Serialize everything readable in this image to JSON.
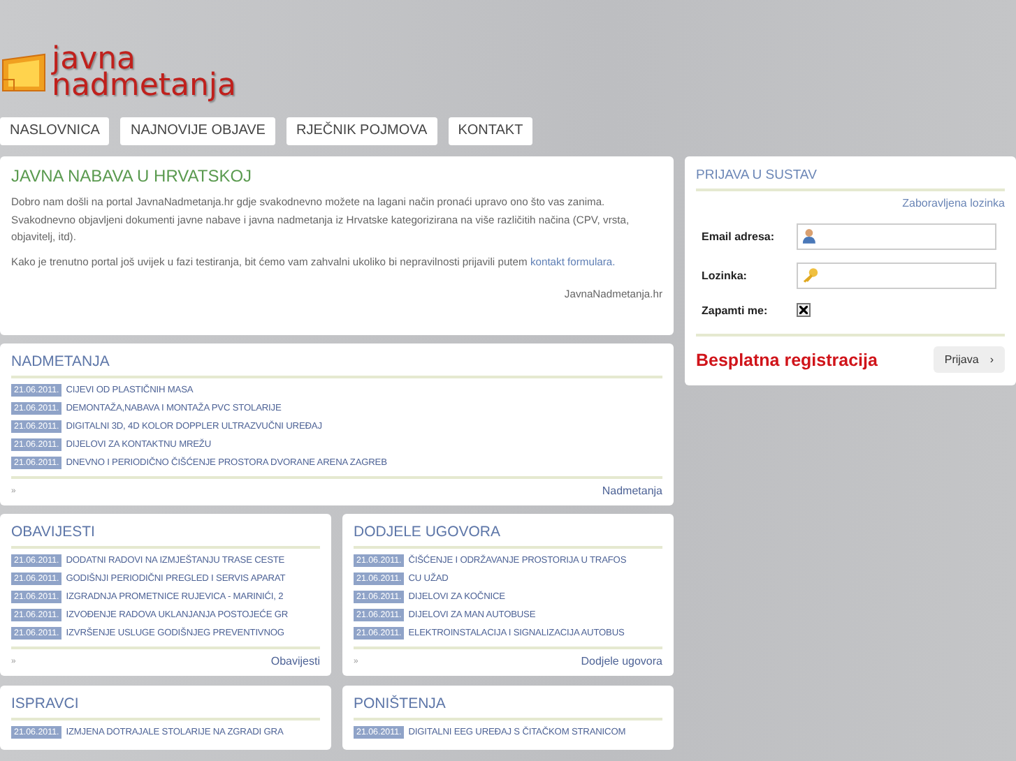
{
  "logo": {
    "line_1": "javna",
    "line_2": "nadmetanja"
  },
  "nav": [
    "NASLOVNICA",
    "NAJNOVIJE OBJAVE",
    "RJEČNIK POJMOVA",
    "KONTAKT"
  ],
  "intro": {
    "title": "JAVNA NABAVA U HRVATSKOJ",
    "paragraph": "Dobro nam došli na portal JavnaNadmetanja.hr gdje svakodnevno možete na lagani način pronaći upravo ono što vas zanima. Svakodnevno objavljeni dokumenti javne nabave i javna nadmetanja iz Hrvatske kategorizirana na više različitih načina (CPV, vrsta, objavitelj, itd).",
    "note": "Kako je trenutno portal još uvijek u fazi testiranja, bit ćemo vam zahvalni ukoliko bi nepravilnosti prijavili putem",
    "note_link": "kontakt formulara.",
    "signature": "JavnaNadmetanja.hr"
  },
  "featured": {
    "title": "NADMETANJA",
    "items": [
      {
        "date": "21.06.2011.",
        "title": "CIJEVI OD PLASTIČNIH MASA"
      },
      {
        "date": "21.06.2011.",
        "title": "DEMONTAŽA,NABAVA I MONTAŽA PVC STOLARIJE"
      },
      {
        "date": "21.06.2011.",
        "title": "DIGITALNI 3D, 4D KOLOR DOPPLER ULTRAZVUČNI UREĐAJ"
      },
      {
        "date": "21.06.2011.",
        "title": "DIJELOVI ZA KONTAKTNU MREŽU"
      },
      {
        "date": "21.06.2011.",
        "title": "DNEVNO I PERIODIČNO ČIŠĆENJE PROSTORA DVORANE ARENA ZAGREB"
      }
    ],
    "more": "»",
    "more_link": "Nadmetanja"
  },
  "sections": [
    {
      "title": "OBAVIJESTI",
      "items": [
        {
          "date": "21.06.2011.",
          "title": "DODATNI RADOVI NA IZMJEŠTANJU TRASE CESTE"
        },
        {
          "date": "21.06.2011.",
          "title": "GODIŠNJI PERIODIČNI PREGLED I SERVIS APARAT"
        },
        {
          "date": "21.06.2011.",
          "title": "IZGRADNJA PROMETNICE RUJEVICA - MARINIĆI, 2"
        },
        {
          "date": "21.06.2011.",
          "title": "IZVOĐENJE RADOVA UKLANJANJA POSTOJEĆE GR"
        },
        {
          "date": "21.06.2011.",
          "title": "IZVRŠENJE USLUGE GODIŠNJEG PREVENTIVNOG"
        }
      ],
      "more": "»",
      "more_link": "Obavijesti"
    },
    {
      "title": "DODJELE UGOVORA",
      "items": [
        {
          "date": "21.06.2011.",
          "title": "ČIŠĆENJE I ODRŽAVANJE PROSTORIJA U TRAFOS"
        },
        {
          "date": "21.06.2011.",
          "title": "CU UŽAD"
        },
        {
          "date": "21.06.2011.",
          "title": "DIJELOVI ZA KOČNICE"
        },
        {
          "date": "21.06.2011.",
          "title": "DIJELOVI ZA MAN AUTOBUSE"
        },
        {
          "date": "21.06.2011.",
          "title": "ELEKTROINSTALACIJA I SIGNALIZACIJA AUTOBUS"
        }
      ],
      "more": "»",
      "more_link": "Dodjele ugovora"
    },
    {
      "title": "ISPRAVCI",
      "items": [
        {
          "date": "21.06.2011.",
          "title": "IZMJENA DOTRAJALE STOLARIJE NA ZGRADI GRA"
        }
      ]
    },
    {
      "title": "PONIŠTENJA",
      "items": [
        {
          "date": "21.06.2011.",
          "title": "DIGITALNI EEG UREĐAJ S ČITAČKOM STRANICOM"
        }
      ]
    }
  ],
  "login": {
    "title": "PRIJAVA U SUSTAV",
    "forgot_link": "Zaboravljena lozinka",
    "email_label": "Email adresa:",
    "password_label": "Lozinka:",
    "remember_label": "Zapamti me:",
    "remember_checked": true,
    "register_link": "Besplatna registracija",
    "submit": "Prijava",
    "submit_arrow": "›"
  }
}
